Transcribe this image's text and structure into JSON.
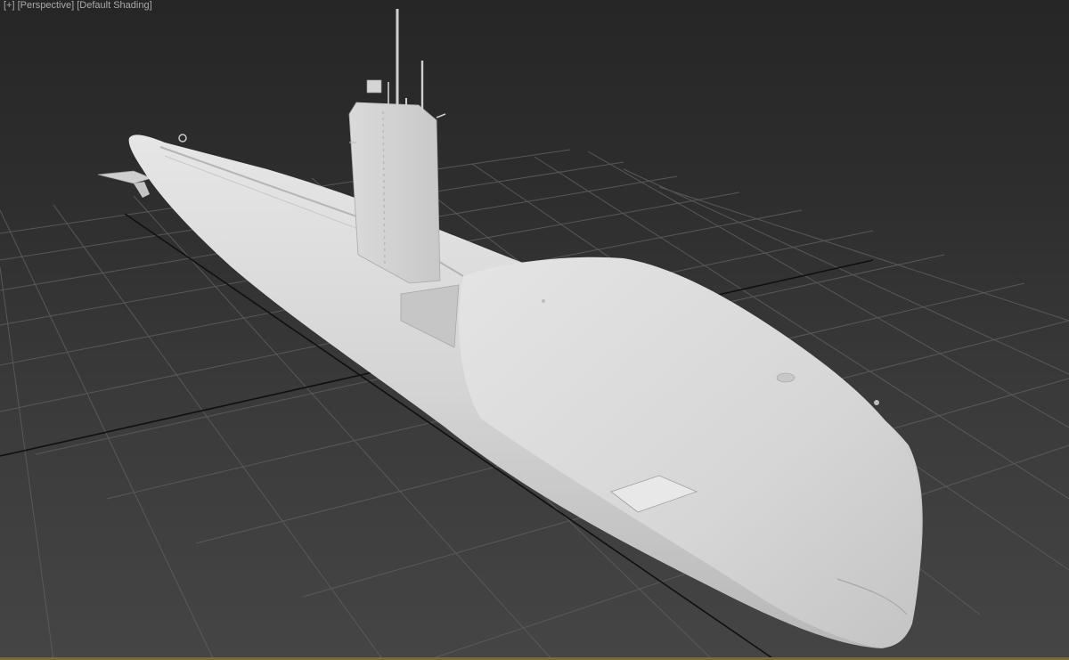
{
  "viewport": {
    "label": "[+] [Perspective] [Default Shading]",
    "background_top": "#262626",
    "background_bottom": "#454545",
    "grid_color": "#5a5a5a",
    "axis_color": "#111111",
    "model_color": "#d9d9d9",
    "border_color": "#7a6a3a"
  },
  "model": {
    "name": "submarine",
    "shading": "default gray"
  }
}
